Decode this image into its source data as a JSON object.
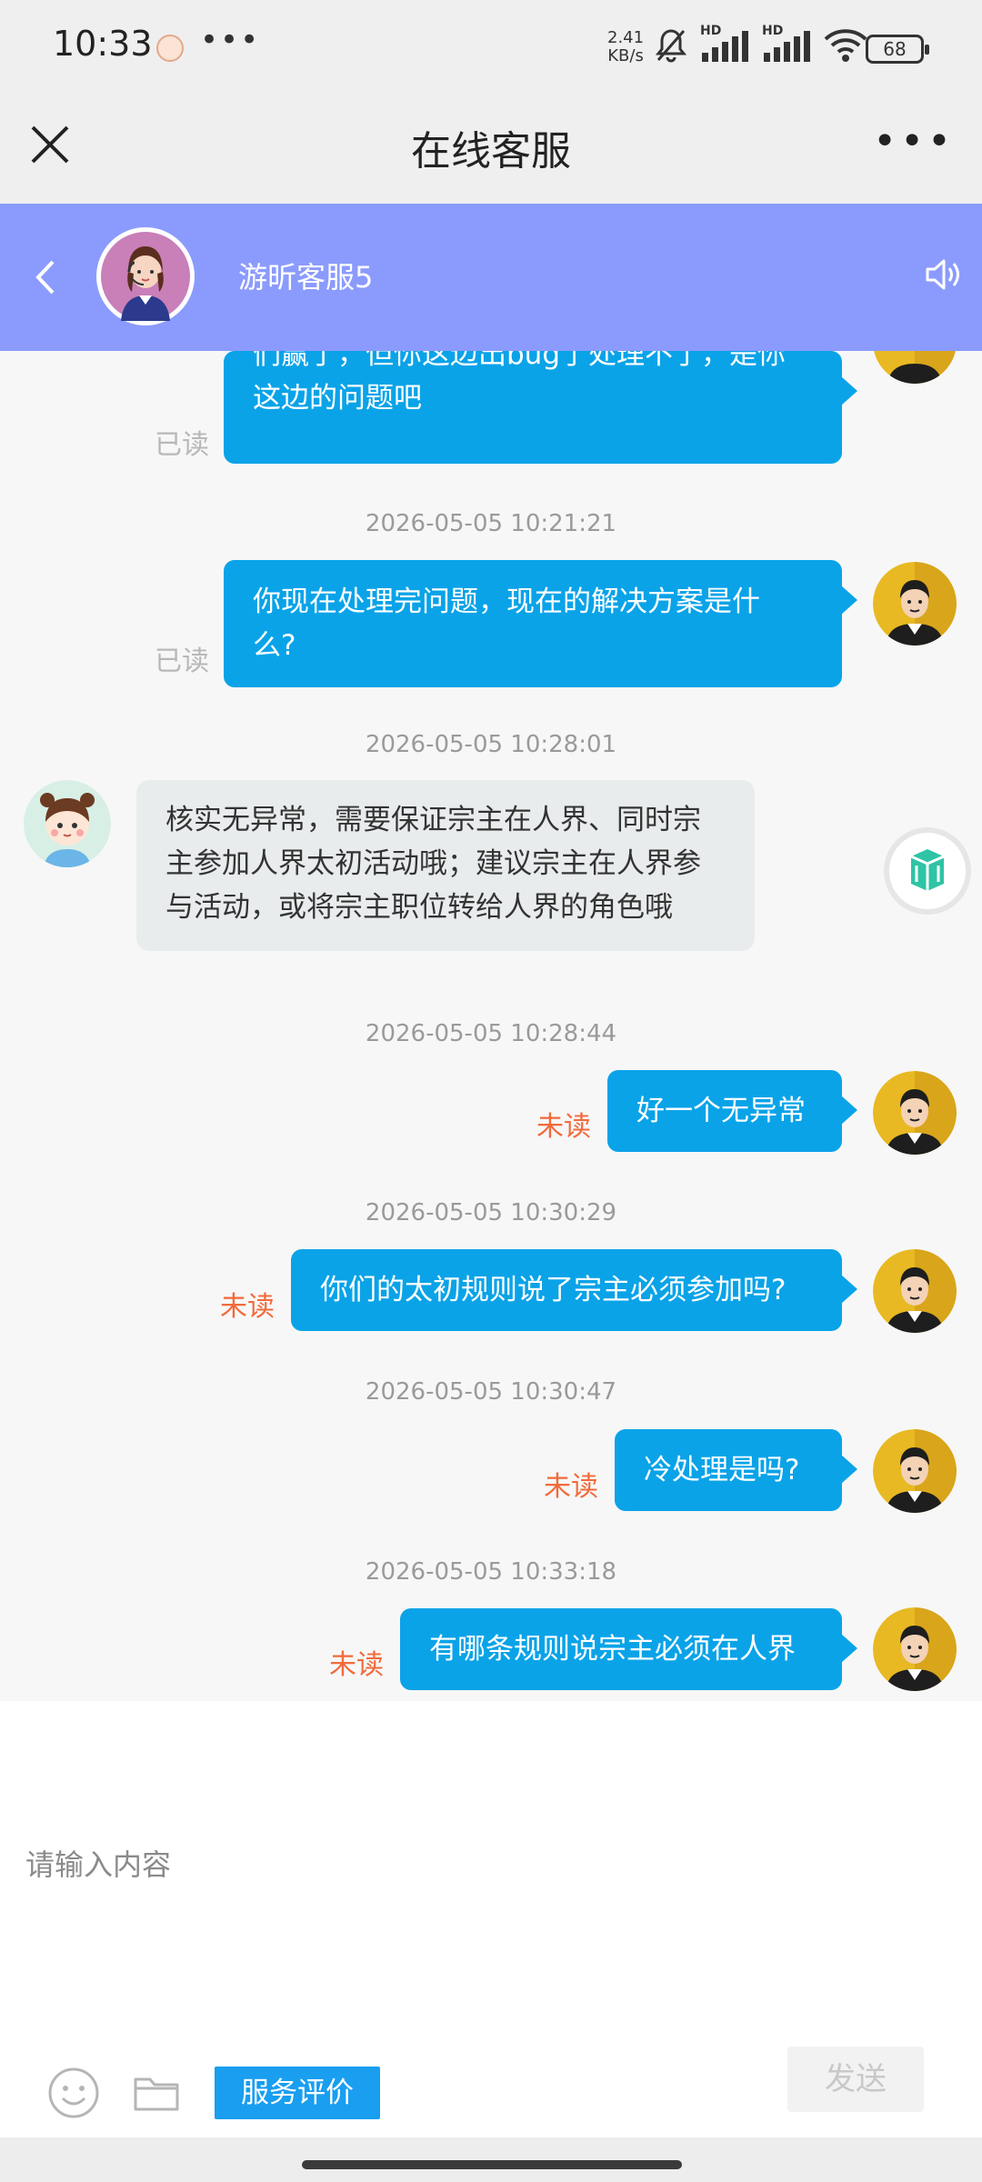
{
  "status_bar": {
    "time": "10:33",
    "more": "•••",
    "net_speed_value": "2.41",
    "net_speed_unit": "KB/s",
    "signal1_label": "HD",
    "signal2_label": "HD",
    "battery": "68"
  },
  "title_bar": {
    "title": "在线客服",
    "more": "•••"
  },
  "agent": {
    "name": "游昕客服5"
  },
  "messages": [
    {
      "side": "out",
      "lines": [
        "们赢了，但你这边出bug了处理不了，是你",
        "这边的问题吧"
      ],
      "status": "已读"
    },
    {
      "timestamp": "2026-05-05 10:21:21",
      "side": "out",
      "lines": [
        "你现在处理完问题，现在的解决方案是什",
        "么?"
      ],
      "status": "已读"
    },
    {
      "timestamp": "2026-05-05 10:28:01",
      "side": "in",
      "lines": [
        "核实无异常，需要保证宗主在人界、同时宗",
        "主参加人界太初活动哦；建议宗主在人界参",
        "与活动，或将宗主职位转给人界的角色哦"
      ]
    },
    {
      "timestamp": "2026-05-05 10:28:44",
      "side": "out",
      "lines": [
        "好一个无异常"
      ],
      "status": "未读"
    },
    {
      "timestamp": "2026-05-05 10:30:29",
      "side": "out",
      "lines": [
        "你们的太初规则说了宗主必须参加吗?"
      ],
      "status": "未读"
    },
    {
      "timestamp": "2026-05-05 10:30:47",
      "side": "out",
      "lines": [
        "冷处理是吗?"
      ],
      "status": "未读"
    },
    {
      "timestamp": "2026-05-05 10:33:18",
      "side": "out",
      "lines": [
        "有哪条规则说宗主必须在人界"
      ],
      "status": "未读"
    }
  ],
  "input": {
    "placeholder": "请输入内容",
    "value": ""
  },
  "toolbar": {
    "rate_label": "服务评价",
    "send_label": "发送"
  },
  "colors": {
    "header_bg": "#8b9bfd",
    "outgoing_bubble": "#0aa3e8",
    "incoming_bubble": "#e9eced",
    "unread": "#f26a3a",
    "rate_button": "#199ef0"
  }
}
